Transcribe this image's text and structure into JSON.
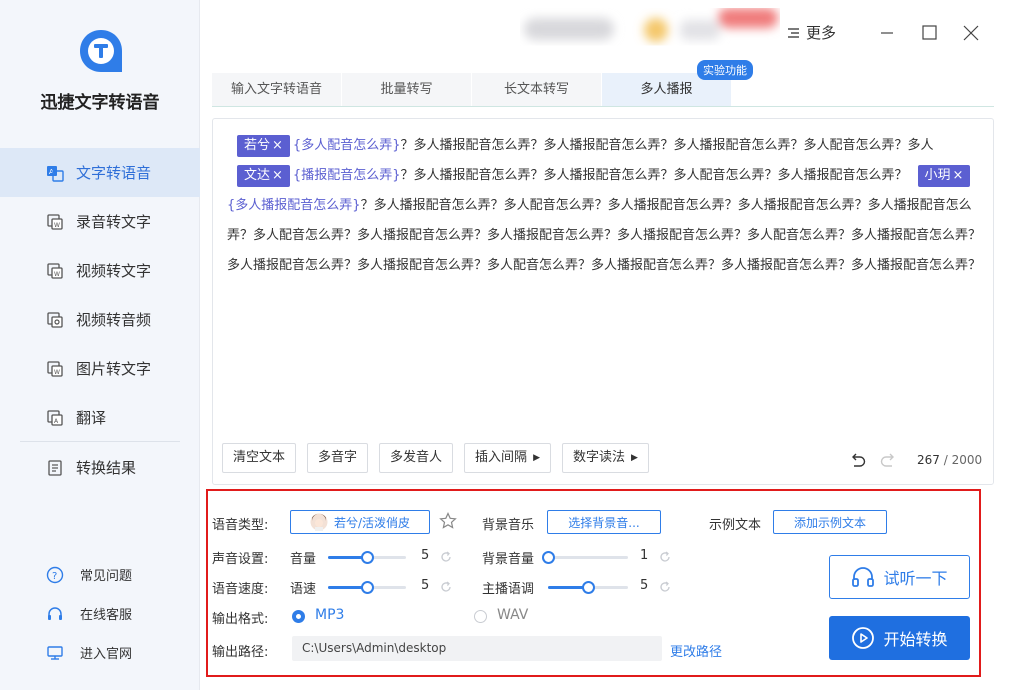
{
  "app": {
    "title": "迅捷文字转语音"
  },
  "sidebar": {
    "items": [
      {
        "label": "文字转语音",
        "icon": "text-to-speech-icon",
        "active": true
      },
      {
        "label": "录音转文字",
        "icon": "recording-to-text-icon",
        "active": false
      },
      {
        "label": "视频转文字",
        "icon": "video-to-text-icon",
        "active": false
      },
      {
        "label": "视频转音频",
        "icon": "video-to-audio-icon",
        "active": false
      },
      {
        "label": "图片转文字",
        "icon": "image-to-text-icon",
        "active": false
      },
      {
        "label": "翻译",
        "icon": "translate-icon",
        "active": false
      },
      {
        "label": "转换结果",
        "icon": "results-icon",
        "active": false
      }
    ],
    "bottom_links": [
      {
        "label": "常见问题",
        "icon": "help-icon"
      },
      {
        "label": "在线客服",
        "icon": "headset-icon"
      },
      {
        "label": "进入官网",
        "icon": "monitor-icon"
      }
    ]
  },
  "titlebar": {
    "more_label": "更多"
  },
  "tabs": [
    {
      "label": "输入文字转语音",
      "active": false
    },
    {
      "label": "批量转写",
      "active": false
    },
    {
      "label": "长文本转写",
      "active": false
    },
    {
      "label": "多人播报",
      "active": true
    }
  ],
  "experimental_badge": "实验功能",
  "editor": {
    "segments": [
      {
        "speaker": "若兮",
        "text": "多人配音怎么弄",
        "tail": "？多人播报配音怎么弄？多人播报配音怎么弄？多人播报配音怎么弄？多人配音怎么弄？多人"
      },
      {
        "speaker": "文达",
        "text": "播报配音怎么弄",
        "tail": "？多人播报配音怎么弄？多人播报配音怎么弄？多人配音怎么弄？多人播报配音怎么弄？"
      },
      {
        "speaker": "小玥",
        "text": "多人播报配音怎么弄",
        "tail": "？多人播报配音怎么弄？多人配音怎么弄？多人播报配音怎么弄？多人播报配音怎么弄？多人播报配音怎么弄？多人配音怎么弄？多人播报配音怎么弄？多人播报配音怎么弄？多人播报配音怎么弄？多人配音怎么弄？多人播报配音怎么弄？多人播报配音怎么弄？多人播报配音怎么弄？多人配音怎么弄？多人播报配音怎么弄？多人播报配音怎么弄？多人播报配音怎么弄？"
      }
    ],
    "chip_close": "×",
    "toolbar": {
      "clear": "清空文本",
      "polyphone": "多音字",
      "multi_speaker": "多发音人",
      "insert_pause": "插入间隔",
      "number_reading": "数字读法"
    },
    "char_count": "267",
    "char_limit": "/ 2000"
  },
  "settings": {
    "voice_type_label": "语音类型:",
    "voice_type_value": "若兮/活泼俏皮",
    "bgm_label": "背景音乐",
    "bgm_button": "选择背景音...",
    "sample_label": "示例文本",
    "sample_button": "添加示例文本",
    "sound_label": "声音设置:",
    "volume_label": "音量",
    "volume_value": "5",
    "volume_level": 0.5,
    "bg_volume_label": "背景音量",
    "bg_volume_value": "1",
    "bg_volume_level": 0.0,
    "speed_section_label": "语音速度:",
    "speed_label": "语速",
    "speed_value": "5",
    "speed_level": 0.5,
    "tone_label": "主播语调",
    "tone_value": "5",
    "tone_level": 0.5,
    "format_label": "输出格式:",
    "format_options": [
      "MP3",
      "WAV"
    ],
    "format_selected": "MP3",
    "path_label": "输出路径:",
    "path_value": "C:\\Users\\Admin\\desktop",
    "change_path": "更改路径",
    "listen_button": "试听一下",
    "start_button": "开始转换"
  },
  "colors": {
    "accent": "#2f7de8",
    "chip": "#5b5fd1",
    "highlight_border": "#e11b1b"
  }
}
